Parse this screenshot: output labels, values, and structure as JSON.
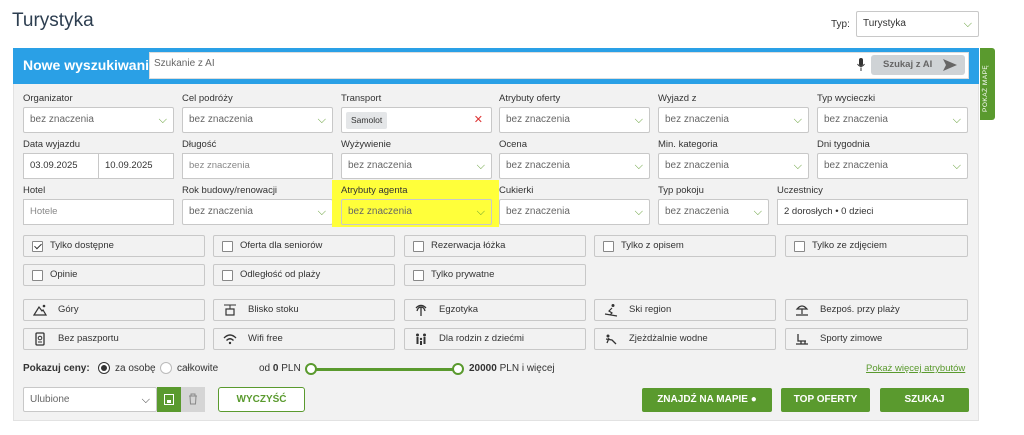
{
  "header": {
    "title": "Turystyka",
    "typ_label": "Typ:",
    "typ_value": "Turystyka"
  },
  "search": {
    "title": "Nowe wyszukiwanie",
    "ai_placeholder": "Szukanie z AI",
    "ai_button": "Szukaj z AI"
  },
  "side_tab": "POKAŻ MAPĘ",
  "filters": {
    "organizator": {
      "label": "Organizator",
      "value": "bez znaczenia"
    },
    "cel": {
      "label": "Cel podróży",
      "value": "bez znaczenia"
    },
    "transport": {
      "label": "Transport",
      "value": "Samolot"
    },
    "atrybuty_oferty": {
      "label": "Atrybuty oferty",
      "value": "bez znaczenia"
    },
    "wyjazd": {
      "label": "Wyjazd z",
      "value": "bez znaczenia"
    },
    "typ_wycieczki": {
      "label": "Typ wycieczki",
      "value": "bez znaczenia"
    },
    "data": {
      "label": "Data wyjazdu",
      "from": "03.09.2025",
      "to": "10.09.2025"
    },
    "dlugosc": {
      "label": "Długość",
      "value": "bez znaczenia"
    },
    "wyzywienie": {
      "label": "Wyżywienie",
      "value": "bez znaczenia"
    },
    "ocena": {
      "label": "Ocena",
      "value": "bez znaczenia"
    },
    "min_kat": {
      "label": "Min. kategoria",
      "value": "bez znaczenia"
    },
    "dni": {
      "label": "Dni tygodnia",
      "value": "bez znaczenia"
    },
    "hotel": {
      "label": "Hotel",
      "placeholder": "Hotele"
    },
    "rok": {
      "label": "Rok budowy/renowacji",
      "value": "bez znaczenia"
    },
    "atrybuty_agenta": {
      "label": "Atrybuty agenta",
      "value": "bez znaczenia"
    },
    "cukierki": {
      "label": "Cukierki",
      "value": "bez znaczenia"
    },
    "typ_pokoju": {
      "label": "Typ pokoju",
      "value": "bez znaczenia"
    },
    "uczestnicy": {
      "label": "Uczestnicy",
      "value": "2 dorosłych • 0 dzieci"
    }
  },
  "checks": [
    "Tylko dostępne",
    "Oferta dla seniorów",
    "Rezerwacja łóżka",
    "Tylko z opisem",
    "Tylko ze zdjęciem",
    "Opinie",
    "Odległość od plaży",
    "Tylko prywatne"
  ],
  "attrs": [
    "Góry",
    "Blisko stoku",
    "Egzotyka",
    "Ski region",
    "Bezpoś. przy plaży",
    "Bez paszportu",
    "Wifi free",
    "Dla rodzin z dziećmi",
    "Zjeżdżalnie wodne",
    "Sporty zimowe"
  ],
  "prices": {
    "label": "Pokazuj ceny:",
    "opt1": "za osobę",
    "opt2": "całkowite",
    "from_label": "od",
    "from_value": "0",
    "from_unit": "PLN",
    "to_value": "20000",
    "to_unit": "PLN i więcej",
    "more": "Pokaż więcej atrybutów"
  },
  "bottom": {
    "ulubione": "Ulubione",
    "clear": "WYCZYŚĆ",
    "map": "ZNAJDŹ NA MAPIE",
    "top": "TOP OFERTY",
    "search": "SZUKAJ"
  }
}
